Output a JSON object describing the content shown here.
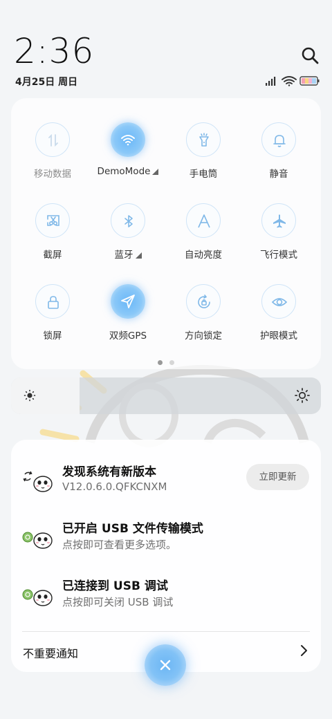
{
  "status": {
    "time": "2:36",
    "date": "4月25日 周日"
  },
  "quick_settings": {
    "tiles": [
      {
        "label": "移动数据",
        "icon": "mobile-data-icon",
        "active": false
      },
      {
        "label": "DemoMode",
        "icon": "wifi-icon",
        "active": true,
        "expandable": true
      },
      {
        "label": "手电筒",
        "icon": "flashlight-icon",
        "active": false
      },
      {
        "label": "静音",
        "icon": "bell-icon",
        "active": false
      },
      {
        "label": "截屏",
        "icon": "screenshot-icon",
        "active": false
      },
      {
        "label": "蓝牙",
        "icon": "bluetooth-icon",
        "active": false,
        "expandable": true
      },
      {
        "label": "自动亮度",
        "icon": "auto-brightness-icon",
        "active": false
      },
      {
        "label": "飞行模式",
        "icon": "airplane-icon",
        "active": false
      },
      {
        "label": "锁屏",
        "icon": "lock-icon",
        "active": false
      },
      {
        "label": "双频GPS",
        "icon": "location-icon",
        "active": true
      },
      {
        "label": "方向锁定",
        "icon": "rotation-lock-icon",
        "active": false
      },
      {
        "label": "护眼模式",
        "icon": "eye-icon",
        "active": false
      }
    ],
    "page_count": 2,
    "current_page": 1
  },
  "brightness": {
    "level": 0.22
  },
  "notifications": [
    {
      "title": "发现系统有新版本",
      "subtitle": "V12.0.6.0.QFKCNXM",
      "action": "立即更新"
    },
    {
      "title": "已开启 USB 文件传输模式",
      "subtitle": "点按即可查看更多选项。"
    },
    {
      "title": "已连接到 USB 调试",
      "subtitle": "点按即可关闭 USB 调试"
    }
  ],
  "footer": {
    "unimportant_label": "不重要通知"
  },
  "colors": {
    "accent": "#6ab7f7",
    "tile_border": "#cfe4f7",
    "icon": "#7fb8e8"
  }
}
